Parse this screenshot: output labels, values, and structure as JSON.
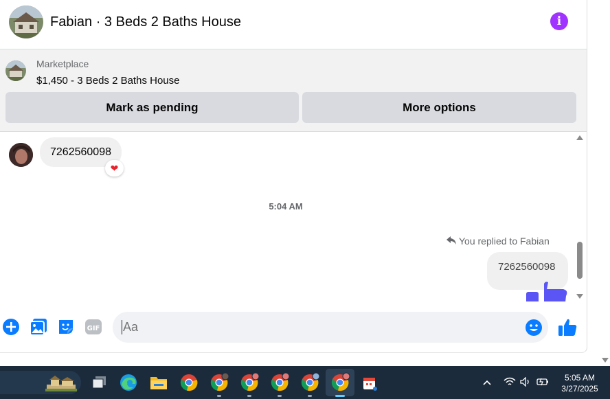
{
  "header": {
    "title": "Fabian · 3 Beds 2 Baths House",
    "info_icon": "info-icon",
    "accent_color": "#a033ff"
  },
  "marketplace": {
    "label": "Marketplace",
    "item": "$1,450 - 3 Beds 2 Baths House",
    "mark_pending_label": "Mark as pending",
    "more_options_label": "More options"
  },
  "messages": {
    "incoming_text": "7262560098",
    "reaction": "❤",
    "timestamp": "5:04 AM",
    "replied_label": "You replied to Fabian",
    "outgoing_text": "7262560098"
  },
  "composer": {
    "placeholder": "Aa",
    "icons": [
      "plus-circle-icon",
      "photo-icon",
      "sticker-icon",
      "gif-icon",
      "emoji-icon",
      "thumbs-up-icon"
    ],
    "gif_label": "GIF",
    "brand_color": "#0a7cff"
  },
  "taskbar": {
    "time": "5:05 AM",
    "date": "3/27/2025",
    "accent_color": "#60cdff"
  }
}
